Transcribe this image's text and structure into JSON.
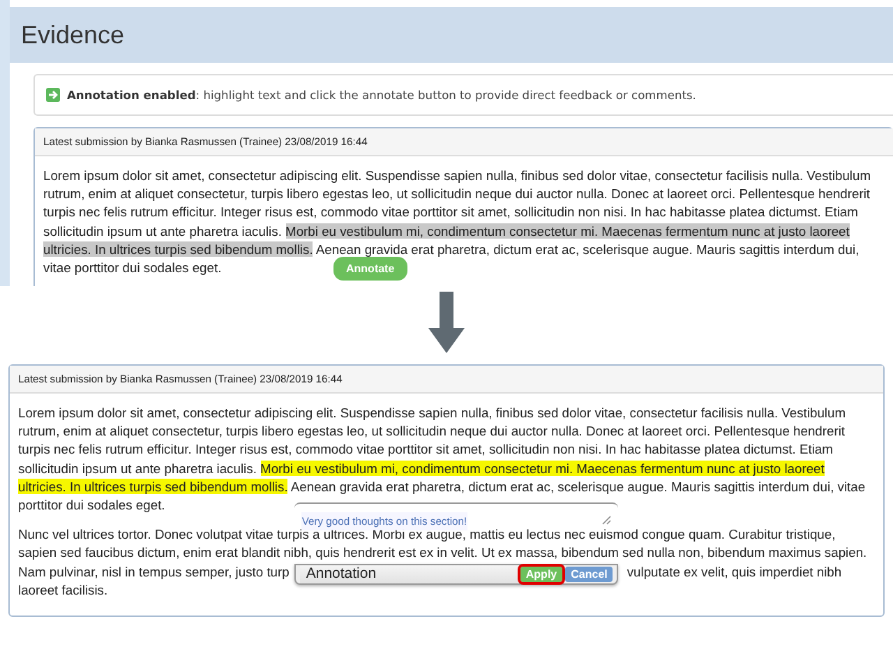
{
  "page_title": "Evidence",
  "notice": {
    "label": "Annotation enabled",
    "text": ": highlight text and click the annotate button to provide direct feedback or comments."
  },
  "before": {
    "submission_header": "Latest submission by Bianka Rasmussen (Trainee) 23/08/2019 16:44",
    "paragraphs": [
      {
        "segments": [
          {
            "text": "Lorem ipsum dolor sit amet, consectetur adipiscing elit. Suspendisse sapien nulla, finibus sed dolor vitae, consectetur facilisis nulla. Vestibulum rutrum, enim at aliquet consectetur, turpis libero egestas leo, ut sollicitudin neque dui auctor nulla. Donec at laoreet orci. Pellentesque hendrerit turpis nec felis rutrum efficitur. Integer risus est, commodo vitae porttitor sit amet, sollicitudin non nisi. In hac habitasse platea dictumst. Etiam sollicitudin ipsum ut ante pharetra iaculis. ",
            "selected": false
          },
          {
            "text": "Morbi eu vestibulum mi, condimentum consectetur mi. Maecenas fermentum nunc at justo laoreet ultricies. In ultrices turpis sed bibendum mollis.",
            "selected": true
          },
          {
            "text": " Aenean gravida erat pharetra, dictum erat ac, scelerisque augue. Mauris sagittis interdum dui, vitae porttitor dui sodales eget.",
            "selected": false
          }
        ]
      }
    ],
    "annotate_button": "Annotate"
  },
  "after": {
    "submission_header": "Latest submission by Bianka Rasmussen (Trainee) 23/08/2019 16:44",
    "paragraphs": [
      {
        "segments": [
          {
            "text": "Lorem ipsum dolor sit amet, consectetur adipiscing elit. Suspendisse sapien nulla, finibus sed dolor vitae, consectetur facilisis nulla. Vestibulum rutrum, enim at aliquet consectetur, turpis libero egestas leo, ut sollicitudin neque dui auctor nulla. Donec at laoreet orci. Pellentesque hendrerit turpis nec felis rutrum efficitur. Integer risus est, commodo vitae porttitor sit amet, sollicitudin non nisi. In hac habitasse platea dictumst. Etiam sollicitudin ipsum ut ante pharetra iaculis. ",
            "annotated": false
          },
          {
            "text": "Morbi eu vestibulum mi, condimentum consectetur mi. Maecenas fermentum nunc at justo laoreet ultricies. In ultrices turpis sed bibendum mollis.",
            "annotated": true
          },
          {
            "text": " Aenean gravida erat pharetra, dictum erat ac, scelerisque augue. Mauris sagittis interdum dui, vitae porttitor dui sodales eget.",
            "annotated": false
          }
        ]
      },
      {
        "segments": [
          {
            "text": "Nunc vel ultrices tortor. Donec volutpat vitae turpis a ultrices. Morbi ex augue, mattis eu lectus nec euismod congue quam. Curabitur tristique, sapien sed faucibus dictum, enim erat blandit nibh, quis hendrerit est ex in velit. Ut ex massa, bibendum sed nulla non, bibendum maximus sapien. Nam pulvinar, nisl in tempus semper, justo turp",
            "annotated": false
          },
          {
            "text": "vulputate ex velit, quis imperdiet nibh laoreet facilisis.",
            "annotated": false
          }
        ]
      }
    ],
    "popup": {
      "comment": "Very good thoughts on this section!",
      "input_value": "Annotation",
      "buttons": [
        {
          "label": "Apply",
          "kind": "apply",
          "outlined": true
        },
        {
          "label": "Cancel",
          "kind": "cancel",
          "outlined": false
        }
      ]
    }
  }
}
